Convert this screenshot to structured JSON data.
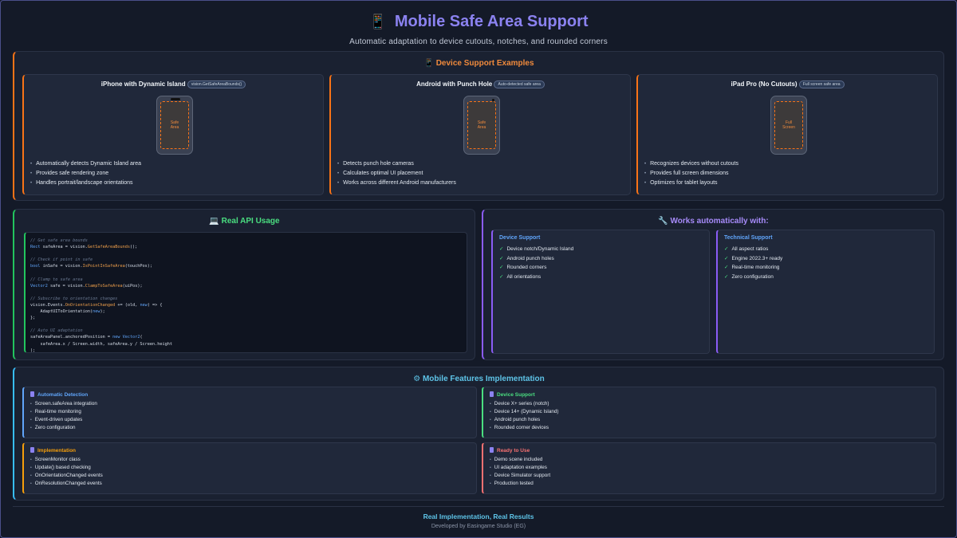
{
  "header": {
    "icon": "mobile-phone-icon",
    "title": "Mobile Safe Area Support",
    "subtitle": "Automatic adaptation to device cutouts, notches, and rounded corners"
  },
  "device_section": {
    "icon": "mobile-phone-icon",
    "title": "Device Support Examples",
    "accent": "#f97316",
    "cards": [
      {
        "title": "iPhone with Dynamic Island",
        "badge": "vision.GetSafeAreaBounds()",
        "screen_label": "Safe Area",
        "features": [
          "Automatically detects Dynamic Island area",
          "Provides safe rendering zone",
          "Handles portrait/landscape orientations"
        ]
      },
      {
        "title": "Android with Punch Hole",
        "badge": "Auto-detected safe area",
        "screen_label": "Safe Area",
        "features": [
          "Detects punch hole cameras",
          "Calculates optimal UI placement",
          "Works across different Android manufacturers"
        ]
      },
      {
        "title": "iPad Pro (No Cutouts)",
        "badge": "Full screen safe area",
        "screen_label": "Full Screen",
        "features": [
          "Recognizes devices without cutouts",
          "Provides full screen dimensions",
          "Optimizes for tablet layouts"
        ]
      }
    ]
  },
  "api_section": {
    "icon": "laptop-icon",
    "title": "Real API Usage",
    "accent": "#22c55e",
    "code_lines": [
      "// Get safe area bounds",
      "Rect safeArea = vision.GetSafeAreaBounds();",
      "",
      "// Check if point in safe",
      "bool inSafe = vision.IsPointInSafeArea(touchPos);",
      "",
      "// Clamp to safe area",
      "Vector2 safe = vision.ClampToSafeArea(uiPos);",
      "",
      "// Subscribe to orientation changes",
      "vision.Events.OnOrientationChanged += (old, new) => {",
      "    AdaptUIToOrientation(new);",
      "};",
      "",
      "// Auto UI adaptation",
      "safeAreaPanel.anchoredPosition = new Vector2(",
      "    safeArea.x / Screen.width, safeArea.y / Screen.height",
      ");"
    ]
  },
  "works_section": {
    "icon": "wrench-icon",
    "title": "Works automatically with:",
    "accent": "#8b5cf6",
    "device_support": {
      "title": "Device Support",
      "items": [
        "Device notch/Dynamic Island",
        "Android punch holes",
        "Rounded corners",
        "All orientations"
      ]
    },
    "technical_support": {
      "title": "Technical Support",
      "items": [
        "All aspect ratios",
        "Engine 2022.3+ ready",
        "Real-time monitoring",
        "Zero configuration"
      ]
    }
  },
  "features_section": {
    "icon": "gear-icon",
    "title": "Mobile Features Implementation",
    "accent": "#38bdf8",
    "boxes": [
      {
        "title": "Automatic Detection",
        "color": "#60a5fa",
        "items": [
          "Screen.safeArea integration",
          "Real-time monitoring",
          "Event-driven updates",
          "Zero configuration"
        ]
      },
      {
        "title": "Device Support",
        "color": "#4ade80",
        "items": [
          "Device X+ series (notch)",
          "Device 14+ (Dynamic Island)",
          "Android punch holes",
          "Rounded corner devices"
        ]
      },
      {
        "title": "Implementation",
        "color": "#f59e0b",
        "items": [
          "ScreenMonitor class",
          "Update() based checking",
          "OnOrientationChanged events",
          "OnResolutionChanged events"
        ]
      },
      {
        "title": "Ready to Use",
        "color": "#f87171",
        "items": [
          "Demo scene included",
          "UI adaptation examples",
          "Device Simulator support",
          "Production tested"
        ]
      }
    ]
  },
  "footer": {
    "tagline": "Real Implementation, Real Results",
    "credit": "Developed by Easingame Studio (EG)"
  }
}
